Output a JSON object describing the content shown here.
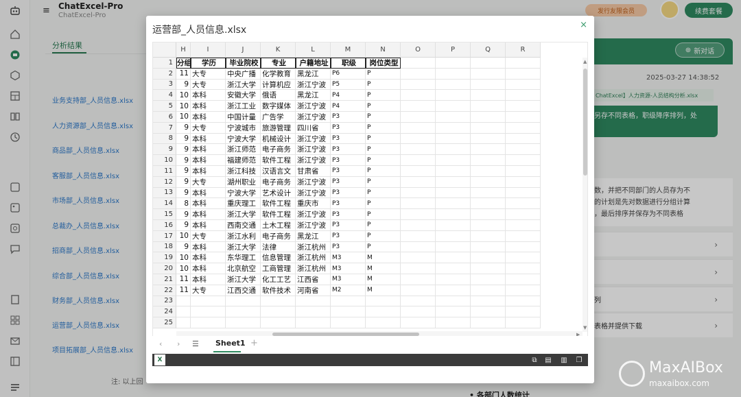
{
  "app": {
    "title": "ChatExcel-Pro",
    "subtitle": "ChatExcel-Pro",
    "member_btn": "发行友限会员",
    "renew_btn": "续费套餐"
  },
  "left_panel": {
    "tab": "分析结果",
    "files": [
      "业务支持部_人员信息.xlsx",
      "人力资源部_人员信息.xlsx",
      "商品部_人员信息.xlsx",
      "客服部_人员信息.xlsx",
      "市场部_人员信息.xlsx",
      "总裁办_人员信息.xlsx",
      "招商部_人员信息.xlsx",
      "综合部_人员信息.xlsx",
      "财务部_人员信息.xlsx",
      "运营部_人员信息.xlsx",
      "项目拓展部_人员信息.xlsx"
    ],
    "note": "注: 以上回"
  },
  "right_panel": {
    "new_chat": "新对话",
    "timestamp": "2025-03-27 14:38:52",
    "file_chip": "ChatExcel】人力资源-人员结构分析.xlsx",
    "bubble": "另存不同表格，职级降序排列，处",
    "reply_lines": [
      "数，并把不同部门的人员存为不",
      "的计划是先对数据进行分组计算",
      "，最后排序并保存为不同表格"
    ],
    "steps": [
      "",
      "",
      "列",
      "表格并提供下载"
    ],
    "bottom": "• 各部门人数统计"
  },
  "modal": {
    "title": "运营部_人员信息.xlsx",
    "close": "×"
  },
  "sheet": {
    "columns": [
      "H",
      "I",
      "J",
      "K",
      "L",
      "M",
      "N",
      "O",
      "P",
      "Q",
      "R"
    ],
    "headers": [
      "分组",
      "学历",
      "毕业院校",
      "专业",
      "户籍地址",
      "职级",
      "岗位类型"
    ],
    "rows": [
      [
        "11",
        "大专",
        "中央广播",
        "化学教育",
        "黑龙江",
        "P6",
        "P"
      ],
      [
        "9",
        "大专",
        "浙江大学",
        "计算机应",
        "浙江宁波",
        "P5",
        "P"
      ],
      [
        "10",
        "本科",
        "安徽大学",
        "俄语",
        "黑龙江",
        "P4",
        "P"
      ],
      [
        "10",
        "本科",
        "浙江工业",
        "数字媒体",
        "浙江宁波",
        "P4",
        "P"
      ],
      [
        "10",
        "本科",
        "中国计量",
        "广告学",
        "浙江宁波",
        "P3",
        "P"
      ],
      [
        "9",
        "大专",
        "宁波城市",
        "旅游管理",
        "四川省",
        "P3",
        "P"
      ],
      [
        "9",
        "本科",
        "宁波大学",
        "机械设计",
        "浙江宁波",
        "P3",
        "P"
      ],
      [
        "9",
        "本科",
        "浙江师范",
        "电子商务",
        "浙江宁波",
        "P3",
        "P"
      ],
      [
        "9",
        "本科",
        "福建师范",
        "软件工程",
        "浙江宁波",
        "P3",
        "P"
      ],
      [
        "9",
        "本科",
        "浙江科技",
        "汉语言文",
        "甘肃省",
        "P3",
        "P"
      ],
      [
        "9",
        "大专",
        "湖州职业",
        "电子商务",
        "浙江宁波",
        "P3",
        "P"
      ],
      [
        "9",
        "本科",
        "宁波大学",
        "艺术设计",
        "浙江宁波",
        "P3",
        "P"
      ],
      [
        "8",
        "本科",
        "重庆理工",
        "软件工程",
        "重庆市",
        "P3",
        "P"
      ],
      [
        "9",
        "本科",
        "浙江大学",
        "软件工程",
        "浙江宁波",
        "P3",
        "P"
      ],
      [
        "9",
        "本科",
        "西南交通",
        "土木工程",
        "浙江宁波",
        "P3",
        "P"
      ],
      [
        "10",
        "大专",
        "浙江水利",
        "电子商务",
        "黑龙江",
        "P3",
        "P"
      ],
      [
        "9",
        "本科",
        "浙江大学",
        "法律",
        "浙江杭州",
        "P3",
        "P"
      ],
      [
        "10",
        "本科",
        "东华理工",
        "信息管理",
        "浙江杭州",
        "M3",
        "M"
      ],
      [
        "10",
        "本科",
        "北京航空",
        "工商管理",
        "浙江杭州",
        "M3",
        "M"
      ],
      [
        "11",
        "本科",
        "浙江大学",
        "化工工艺",
        "江西省",
        "M3",
        "M"
      ],
      [
        "11",
        "大专",
        "江西交通",
        "软件技术",
        "河南省",
        "M2",
        "M"
      ]
    ],
    "row_numbers": [
      "1",
      "2",
      "3",
      "4",
      "5",
      "6",
      "7",
      "8",
      "9",
      "10",
      "11",
      "12",
      "13",
      "14",
      "15",
      "16",
      "17",
      "18",
      "19",
      "20",
      "21",
      "22",
      "23",
      "24",
      "25"
    ],
    "tab_name": "Sheet1"
  },
  "watermark": {
    "line1": "MaxAIBox",
    "line2": "maxaibox.com"
  },
  "colors": {
    "accent": "#2f8a61",
    "link": "#2e79c9"
  }
}
